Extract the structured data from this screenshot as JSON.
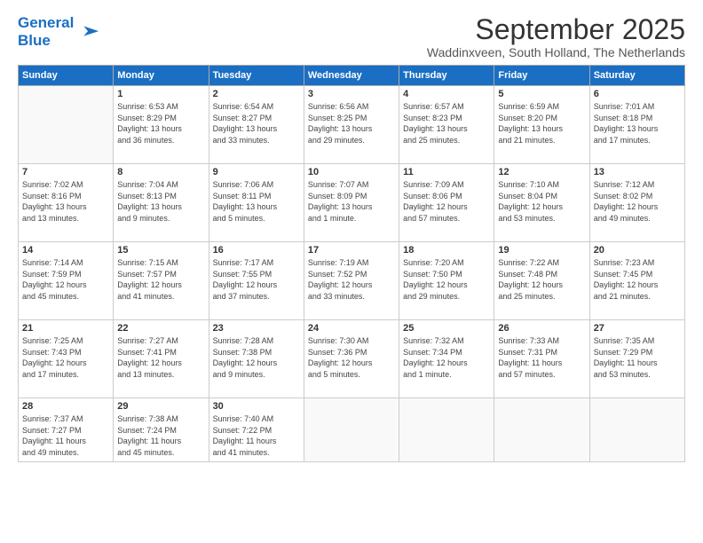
{
  "logo": {
    "line1": "General",
    "line2": "Blue"
  },
  "title": "September 2025",
  "location": "Waddinxveen, South Holland, The Netherlands",
  "days_of_week": [
    "Sunday",
    "Monday",
    "Tuesday",
    "Wednesday",
    "Thursday",
    "Friday",
    "Saturday"
  ],
  "weeks": [
    [
      {
        "num": "",
        "info": ""
      },
      {
        "num": "1",
        "info": "Sunrise: 6:53 AM\nSunset: 8:29 PM\nDaylight: 13 hours\nand 36 minutes."
      },
      {
        "num": "2",
        "info": "Sunrise: 6:54 AM\nSunset: 8:27 PM\nDaylight: 13 hours\nand 33 minutes."
      },
      {
        "num": "3",
        "info": "Sunrise: 6:56 AM\nSunset: 8:25 PM\nDaylight: 13 hours\nand 29 minutes."
      },
      {
        "num": "4",
        "info": "Sunrise: 6:57 AM\nSunset: 8:23 PM\nDaylight: 13 hours\nand 25 minutes."
      },
      {
        "num": "5",
        "info": "Sunrise: 6:59 AM\nSunset: 8:20 PM\nDaylight: 13 hours\nand 21 minutes."
      },
      {
        "num": "6",
        "info": "Sunrise: 7:01 AM\nSunset: 8:18 PM\nDaylight: 13 hours\nand 17 minutes."
      }
    ],
    [
      {
        "num": "7",
        "info": "Sunrise: 7:02 AM\nSunset: 8:16 PM\nDaylight: 13 hours\nand 13 minutes."
      },
      {
        "num": "8",
        "info": "Sunrise: 7:04 AM\nSunset: 8:13 PM\nDaylight: 13 hours\nand 9 minutes."
      },
      {
        "num": "9",
        "info": "Sunrise: 7:06 AM\nSunset: 8:11 PM\nDaylight: 13 hours\nand 5 minutes."
      },
      {
        "num": "10",
        "info": "Sunrise: 7:07 AM\nSunset: 8:09 PM\nDaylight: 13 hours\nand 1 minute."
      },
      {
        "num": "11",
        "info": "Sunrise: 7:09 AM\nSunset: 8:06 PM\nDaylight: 12 hours\nand 57 minutes."
      },
      {
        "num": "12",
        "info": "Sunrise: 7:10 AM\nSunset: 8:04 PM\nDaylight: 12 hours\nand 53 minutes."
      },
      {
        "num": "13",
        "info": "Sunrise: 7:12 AM\nSunset: 8:02 PM\nDaylight: 12 hours\nand 49 minutes."
      }
    ],
    [
      {
        "num": "14",
        "info": "Sunrise: 7:14 AM\nSunset: 7:59 PM\nDaylight: 12 hours\nand 45 minutes."
      },
      {
        "num": "15",
        "info": "Sunrise: 7:15 AM\nSunset: 7:57 PM\nDaylight: 12 hours\nand 41 minutes."
      },
      {
        "num": "16",
        "info": "Sunrise: 7:17 AM\nSunset: 7:55 PM\nDaylight: 12 hours\nand 37 minutes."
      },
      {
        "num": "17",
        "info": "Sunrise: 7:19 AM\nSunset: 7:52 PM\nDaylight: 12 hours\nand 33 minutes."
      },
      {
        "num": "18",
        "info": "Sunrise: 7:20 AM\nSunset: 7:50 PM\nDaylight: 12 hours\nand 29 minutes."
      },
      {
        "num": "19",
        "info": "Sunrise: 7:22 AM\nSunset: 7:48 PM\nDaylight: 12 hours\nand 25 minutes."
      },
      {
        "num": "20",
        "info": "Sunrise: 7:23 AM\nSunset: 7:45 PM\nDaylight: 12 hours\nand 21 minutes."
      }
    ],
    [
      {
        "num": "21",
        "info": "Sunrise: 7:25 AM\nSunset: 7:43 PM\nDaylight: 12 hours\nand 17 minutes."
      },
      {
        "num": "22",
        "info": "Sunrise: 7:27 AM\nSunset: 7:41 PM\nDaylight: 12 hours\nand 13 minutes."
      },
      {
        "num": "23",
        "info": "Sunrise: 7:28 AM\nSunset: 7:38 PM\nDaylight: 12 hours\nand 9 minutes."
      },
      {
        "num": "24",
        "info": "Sunrise: 7:30 AM\nSunset: 7:36 PM\nDaylight: 12 hours\nand 5 minutes."
      },
      {
        "num": "25",
        "info": "Sunrise: 7:32 AM\nSunset: 7:34 PM\nDaylight: 12 hours\nand 1 minute."
      },
      {
        "num": "26",
        "info": "Sunrise: 7:33 AM\nSunset: 7:31 PM\nDaylight: 11 hours\nand 57 minutes."
      },
      {
        "num": "27",
        "info": "Sunrise: 7:35 AM\nSunset: 7:29 PM\nDaylight: 11 hours\nand 53 minutes."
      }
    ],
    [
      {
        "num": "28",
        "info": "Sunrise: 7:37 AM\nSunset: 7:27 PM\nDaylight: 11 hours\nand 49 minutes."
      },
      {
        "num": "29",
        "info": "Sunrise: 7:38 AM\nSunset: 7:24 PM\nDaylight: 11 hours\nand 45 minutes."
      },
      {
        "num": "30",
        "info": "Sunrise: 7:40 AM\nSunset: 7:22 PM\nDaylight: 11 hours\nand 41 minutes."
      },
      {
        "num": "",
        "info": ""
      },
      {
        "num": "",
        "info": ""
      },
      {
        "num": "",
        "info": ""
      },
      {
        "num": "",
        "info": ""
      }
    ]
  ]
}
